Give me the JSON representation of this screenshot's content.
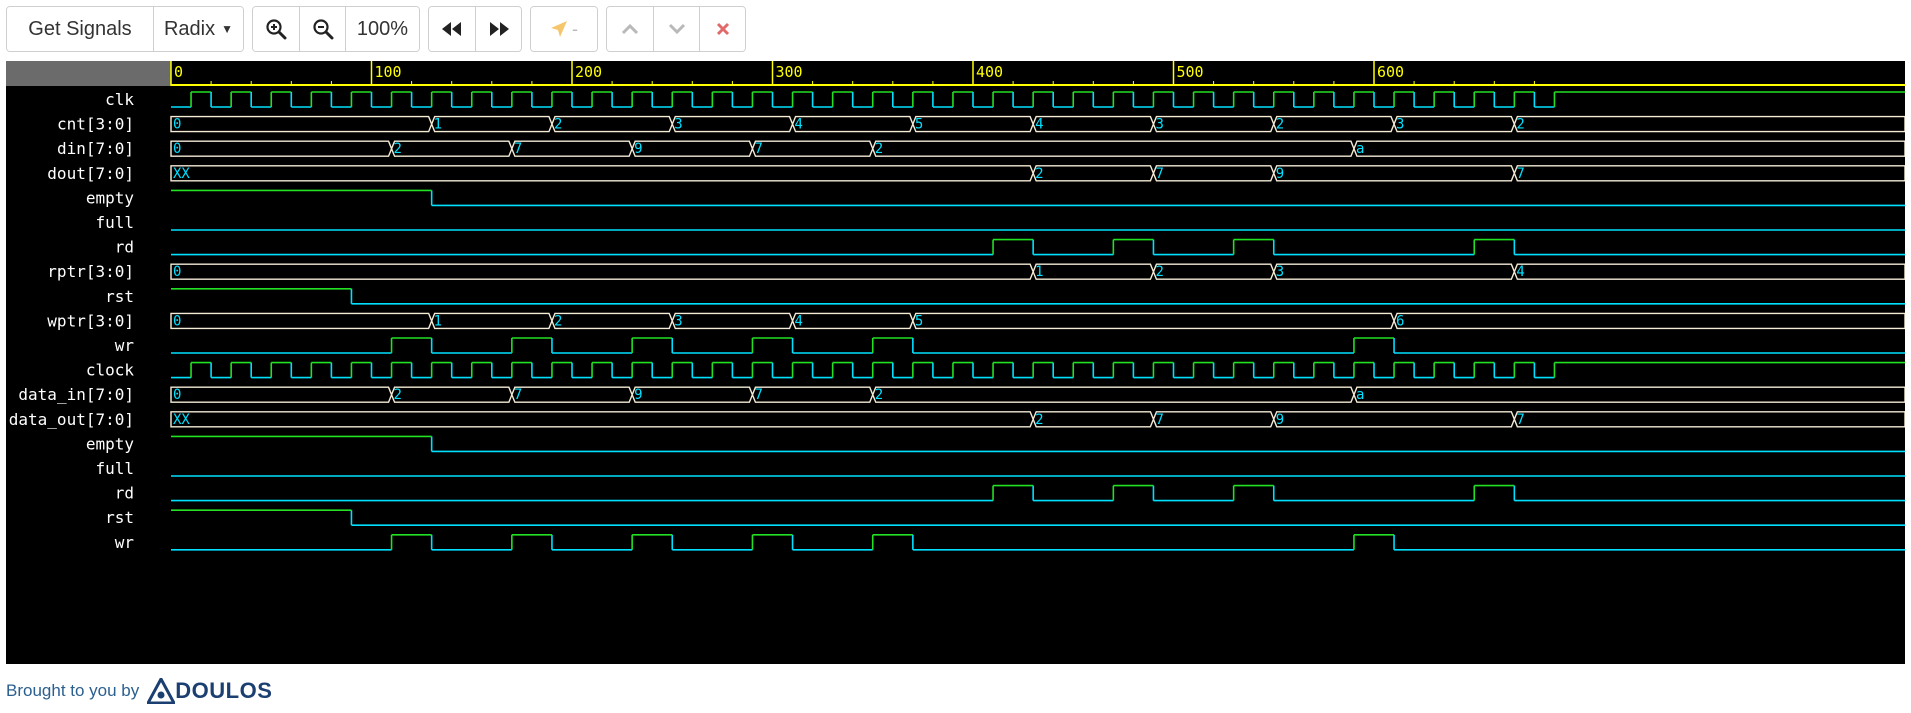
{
  "toolbar": {
    "get_signals": "Get Signals",
    "radix": "Radix",
    "zoom_level": "100%",
    "marker_label": "-"
  },
  "timeline": {
    "ticks": [
      "0",
      "100",
      "200",
      "300",
      "400",
      "500",
      "600"
    ],
    "tick_step": 100,
    "minor_step": 20,
    "time_end": 690,
    "clock_half_period": 10
  },
  "colors": {
    "background": "#000000",
    "ruler": "#6b6b6b",
    "ruler_accent": "#ffff00",
    "low": "#00e0ff",
    "high": "#22e022",
    "bus": "#f5ecd7",
    "bus_value": "#00e0ff",
    "label": "#ffffff"
  },
  "signals": [
    {
      "name": "clk",
      "type": "clock",
      "period": 20
    },
    {
      "name": "cnt[3:0]",
      "type": "bus",
      "changes": [
        [
          0,
          "0"
        ],
        [
          130,
          "1"
        ],
        [
          190,
          "2"
        ],
        [
          250,
          "3"
        ],
        [
          310,
          "4"
        ],
        [
          370,
          "5"
        ],
        [
          430,
          "4"
        ],
        [
          490,
          "3"
        ],
        [
          550,
          "2"
        ],
        [
          610,
          "3"
        ],
        [
          670,
          "2"
        ]
      ]
    },
    {
      "name": "din[7:0]",
      "type": "bus",
      "changes": [
        [
          0,
          "0"
        ],
        [
          110,
          "2"
        ],
        [
          170,
          "7"
        ],
        [
          230,
          "9"
        ],
        [
          290,
          "7"
        ],
        [
          350,
          "2"
        ],
        [
          590,
          "a"
        ]
      ]
    },
    {
      "name": "dout[7:0]",
      "type": "bus",
      "changes": [
        [
          0,
          "XX"
        ],
        [
          430,
          "2"
        ],
        [
          490,
          "7"
        ],
        [
          550,
          "9"
        ],
        [
          670,
          "7"
        ]
      ]
    },
    {
      "name": "empty",
      "type": "bit",
      "init": 1,
      "edges": [
        130
      ]
    },
    {
      "name": "full",
      "type": "bit",
      "init": 0,
      "edges": []
    },
    {
      "name": "rd",
      "type": "bit",
      "init": 0,
      "edges": [
        410,
        430,
        470,
        490,
        530,
        550,
        650,
        670
      ]
    },
    {
      "name": "rptr[3:0]",
      "type": "bus",
      "changes": [
        [
          0,
          "0"
        ],
        [
          430,
          "1"
        ],
        [
          490,
          "2"
        ],
        [
          550,
          "3"
        ],
        [
          670,
          "4"
        ]
      ]
    },
    {
      "name": "rst",
      "type": "bit",
      "init": 1,
      "edges": [
        90
      ]
    },
    {
      "name": "wptr[3:0]",
      "type": "bus",
      "changes": [
        [
          0,
          "0"
        ],
        [
          130,
          "1"
        ],
        [
          190,
          "2"
        ],
        [
          250,
          "3"
        ],
        [
          310,
          "4"
        ],
        [
          370,
          "5"
        ],
        [
          610,
          "6"
        ]
      ]
    },
    {
      "name": "wr",
      "type": "bit",
      "init": 0,
      "edges": [
        110,
        130,
        170,
        190,
        230,
        250,
        290,
        310,
        350,
        370,
        590,
        610
      ]
    },
    {
      "name": "clock",
      "type": "clock",
      "period": 20
    },
    {
      "name": "data_in[7:0]",
      "type": "bus",
      "changes": [
        [
          0,
          "0"
        ],
        [
          110,
          "2"
        ],
        [
          170,
          "7"
        ],
        [
          230,
          "9"
        ],
        [
          290,
          "7"
        ],
        [
          350,
          "2"
        ],
        [
          590,
          "a"
        ]
      ]
    },
    {
      "name": "data_out[7:0]",
      "type": "bus",
      "changes": [
        [
          0,
          "XX"
        ],
        [
          430,
          "2"
        ],
        [
          490,
          "7"
        ],
        [
          550,
          "9"
        ],
        [
          670,
          "7"
        ]
      ]
    },
    {
      "name": "empty",
      "type": "bit",
      "init": 1,
      "edges": [
        130
      ]
    },
    {
      "name": "full",
      "type": "bit",
      "init": 0,
      "edges": []
    },
    {
      "name": "rd",
      "type": "bit",
      "init": 0,
      "edges": [
        410,
        430,
        470,
        490,
        530,
        550,
        650,
        670
      ]
    },
    {
      "name": "rst",
      "type": "bit",
      "init": 1,
      "edges": [
        90
      ]
    },
    {
      "name": "wr",
      "type": "bit",
      "init": 0,
      "edges": [
        110,
        130,
        170,
        190,
        230,
        250,
        290,
        310,
        350,
        370,
        590,
        610
      ]
    }
  ],
  "footer": {
    "text": "Brought to you by",
    "brand": "DOULOS"
  }
}
